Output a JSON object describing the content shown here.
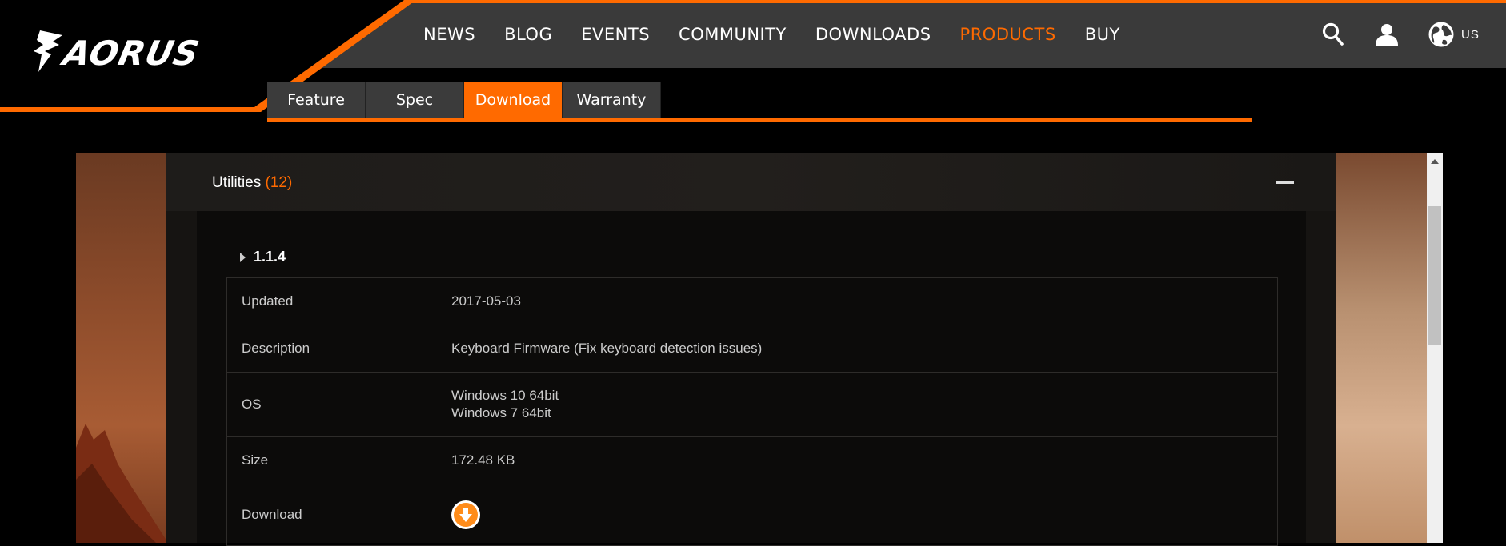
{
  "brand": {
    "name": "AORUS"
  },
  "nav": {
    "items": [
      {
        "label": "NEWS",
        "active": false
      },
      {
        "label": "BLOG",
        "active": false
      },
      {
        "label": "EVENTS",
        "active": false
      },
      {
        "label": "COMMUNITY",
        "active": false
      },
      {
        "label": "DOWNLOADS",
        "active": false
      },
      {
        "label": "PRODUCTS",
        "active": true
      },
      {
        "label": "BUY",
        "active": false
      }
    ],
    "lang": "US"
  },
  "tabs": [
    {
      "label": "Feature",
      "active": false
    },
    {
      "label": "Spec",
      "active": false
    },
    {
      "label": "Download",
      "active": true
    },
    {
      "label": "Warranty",
      "active": false
    }
  ],
  "section": {
    "title": "Utilities",
    "count": "(12)"
  },
  "entry": {
    "version": "1.1.4",
    "rows": {
      "updated": {
        "label": "Updated",
        "value": "2017-05-03"
      },
      "description": {
        "label": "Description",
        "value": "Keyboard Firmware (Fix keyboard detection issues)"
      },
      "os": {
        "label": "OS",
        "values": [
          "Windows 10 64bit",
          "Windows 7 64bit"
        ]
      },
      "size": {
        "label": "Size",
        "value": "172.48 KB"
      },
      "download": {
        "label": "Download"
      }
    }
  },
  "colors": {
    "accent": "#ff6a00",
    "nav_band": "#3a3a3a",
    "background": "#000000",
    "download_icon": "#ff8c1a"
  },
  "icons": [
    "search-icon",
    "user-icon",
    "globe-icon",
    "caret-right-icon",
    "minus-icon",
    "download-arrow-icon",
    "scroll-up-arrow-icon"
  ]
}
